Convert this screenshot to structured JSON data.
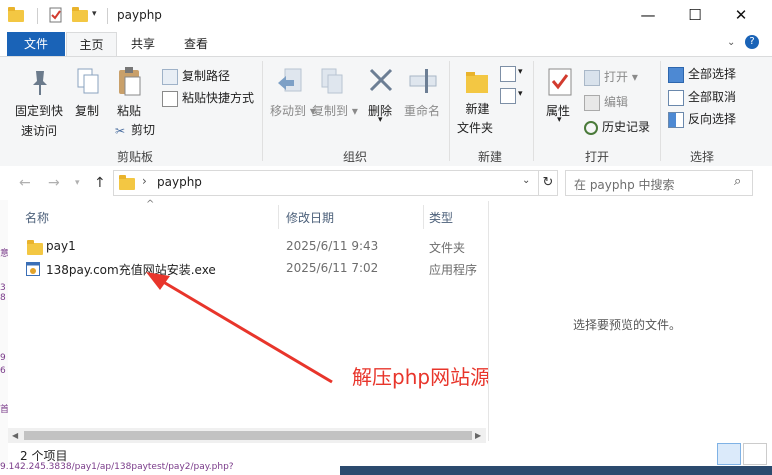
{
  "window": {
    "title": "payphp",
    "minimize_glyph": "—",
    "maximize_glyph": "☐",
    "close_glyph": "✕"
  },
  "ribbon_tabs": {
    "file": "文件",
    "home": "主页",
    "share": "共享",
    "view": "查看"
  },
  "ribbon": {
    "clipboard": {
      "label": "剪贴板",
      "pin_line1": "固定到快",
      "pin_line2": "速访问",
      "copy": "复制",
      "paste": "粘贴",
      "copy_path": "复制路径",
      "paste_shortcut": "粘贴快捷方式",
      "cut": "剪切"
    },
    "organize": {
      "label": "组织",
      "move_to": "移动到",
      "copy_to": "复制到",
      "delete": "删除",
      "rename": "重命名"
    },
    "new": {
      "label": "新建",
      "new_folder_line1": "新建",
      "new_folder_line2": "文件夹"
    },
    "open": {
      "label": "打开",
      "properties": "属性",
      "open": "打开",
      "edit": "编辑",
      "history": "历史记录"
    },
    "select": {
      "label": "选择",
      "select_all": "全部选择",
      "select_none": "全部取消",
      "invert": "反向选择"
    }
  },
  "address": {
    "path": "payphp",
    "search_placeholder": "在 payphp 中搜索"
  },
  "columns": {
    "name": "名称",
    "modified": "修改日期",
    "type": "类型"
  },
  "files": [
    {
      "name": "pay1",
      "modified": "2025/6/11 9:43",
      "type": "文件夹",
      "icon": "folder-icon"
    },
    {
      "name": "138pay.com充值网站安装.exe",
      "modified": "2025/6/11 7:02",
      "type": "应用程序",
      "icon": "exe-icon"
    }
  ],
  "annotation": {
    "text": "解压php网站源码并且运行",
    "color": "#e8352b"
  },
  "preview": {
    "empty_text": "选择要预览的文件。"
  },
  "status": {
    "item_count": "2 个项目"
  },
  "background_text": {
    "url_fragment": "9.142.245.3838/pay1/ap/138paytest/pay2/pay.php?"
  },
  "colors": {
    "accent": "#1a63b7",
    "folder": "#f3c743",
    "arrow": "#e8352b"
  }
}
